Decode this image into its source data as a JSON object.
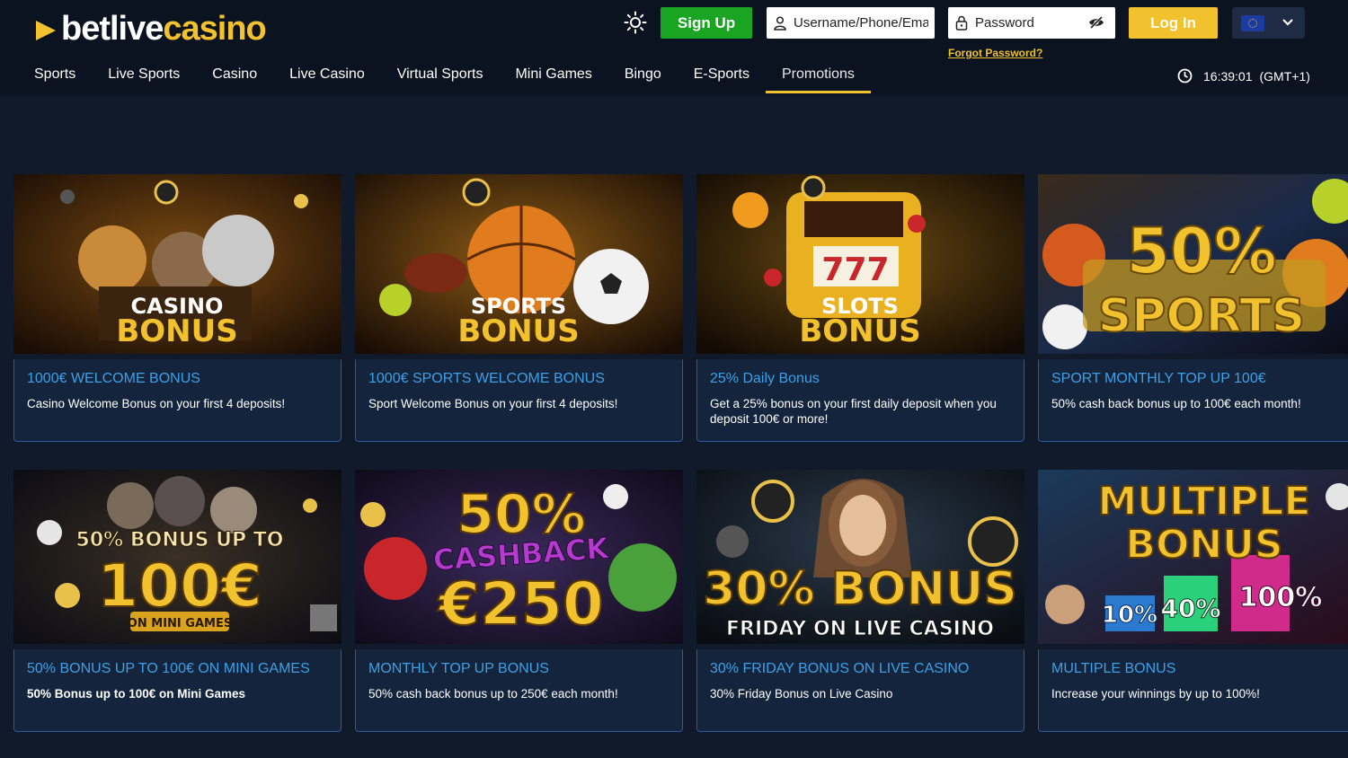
{
  "brand": {
    "name_part1": "betlive",
    "name_part2": "casino",
    "accent": "#f2c12e",
    "signup_green": "#19a521"
  },
  "header": {
    "signup_label": "Sign Up",
    "username_placeholder": "Username/Phone/Email",
    "password_placeholder": "Password",
    "forgot_label": "Forgot Password?",
    "login_label": "Log In",
    "language_icon": "eu-flag-icon"
  },
  "nav": [
    {
      "label": "Sports"
    },
    {
      "label": "Live Sports"
    },
    {
      "label": "Casino"
    },
    {
      "label": "Live Casino"
    },
    {
      "label": "Virtual Sports"
    },
    {
      "label": "Mini Games"
    },
    {
      "label": "Bingo"
    },
    {
      "label": "E-Sports"
    },
    {
      "label": "Promotions",
      "active": true
    }
  ],
  "clock": {
    "time": "16:39:01",
    "timezone": "(GMT+1)"
  },
  "promotions": [
    {
      "banner_line1": "CASINO",
      "banner_line2": "BONUS",
      "title": "1000€ WELCOME BONUS",
      "desc": "Casino Welcome Bonus on your first 4 deposits!"
    },
    {
      "banner_line1": "SPORTS",
      "banner_line2": "BONUS",
      "title": "1000€ SPORTS WELCOME BONUS",
      "desc": "Sport Welcome Bonus on your first 4 deposits!"
    },
    {
      "banner_line1": "SLOTS",
      "banner_line2": "BONUS",
      "reel_text": "777",
      "title": "25% Daily Bonus",
      "desc": "Get a 25% bonus on your first daily deposit when you deposit 100€ or more!"
    },
    {
      "banner_line1": "50%",
      "banner_line2": "SPORTS",
      "title": "SPORT MONTHLY TOP UP 100€",
      "desc": "50% cash back bonus up to 100€ each month!"
    },
    {
      "banner_line1": "50% BONUS UP TO",
      "banner_line2": "100€",
      "banner_line3": "ON MINI GAMES",
      "title": "50% BONUS UP TO 100€ ON MINI GAMES",
      "desc": "50% Bonus up to 100€ on Mini Games"
    },
    {
      "banner_line1": "50%",
      "banner_line2": "CASHBACK",
      "banner_line3": "€250",
      "title": "MONTHLY TOP UP BONUS",
      "desc": "50% cash back bonus up to 250€ each month!"
    },
    {
      "banner_line1": "30% BONUS",
      "banner_line2": "FRIDAY ON LIVE CASINO",
      "title": "30% FRIDAY BONUS ON LIVE CASINO",
      "desc": "30% Friday Bonus on Live Casino"
    },
    {
      "banner_line1": "MULTIPLE",
      "banner_line2": "BONUS",
      "banner_line3": "10%",
      "banner_line4": "40%",
      "banner_line5": "100%",
      "title": "MULTIPLE BONUS",
      "desc": "Increase your winnings by up to 100%!"
    }
  ]
}
